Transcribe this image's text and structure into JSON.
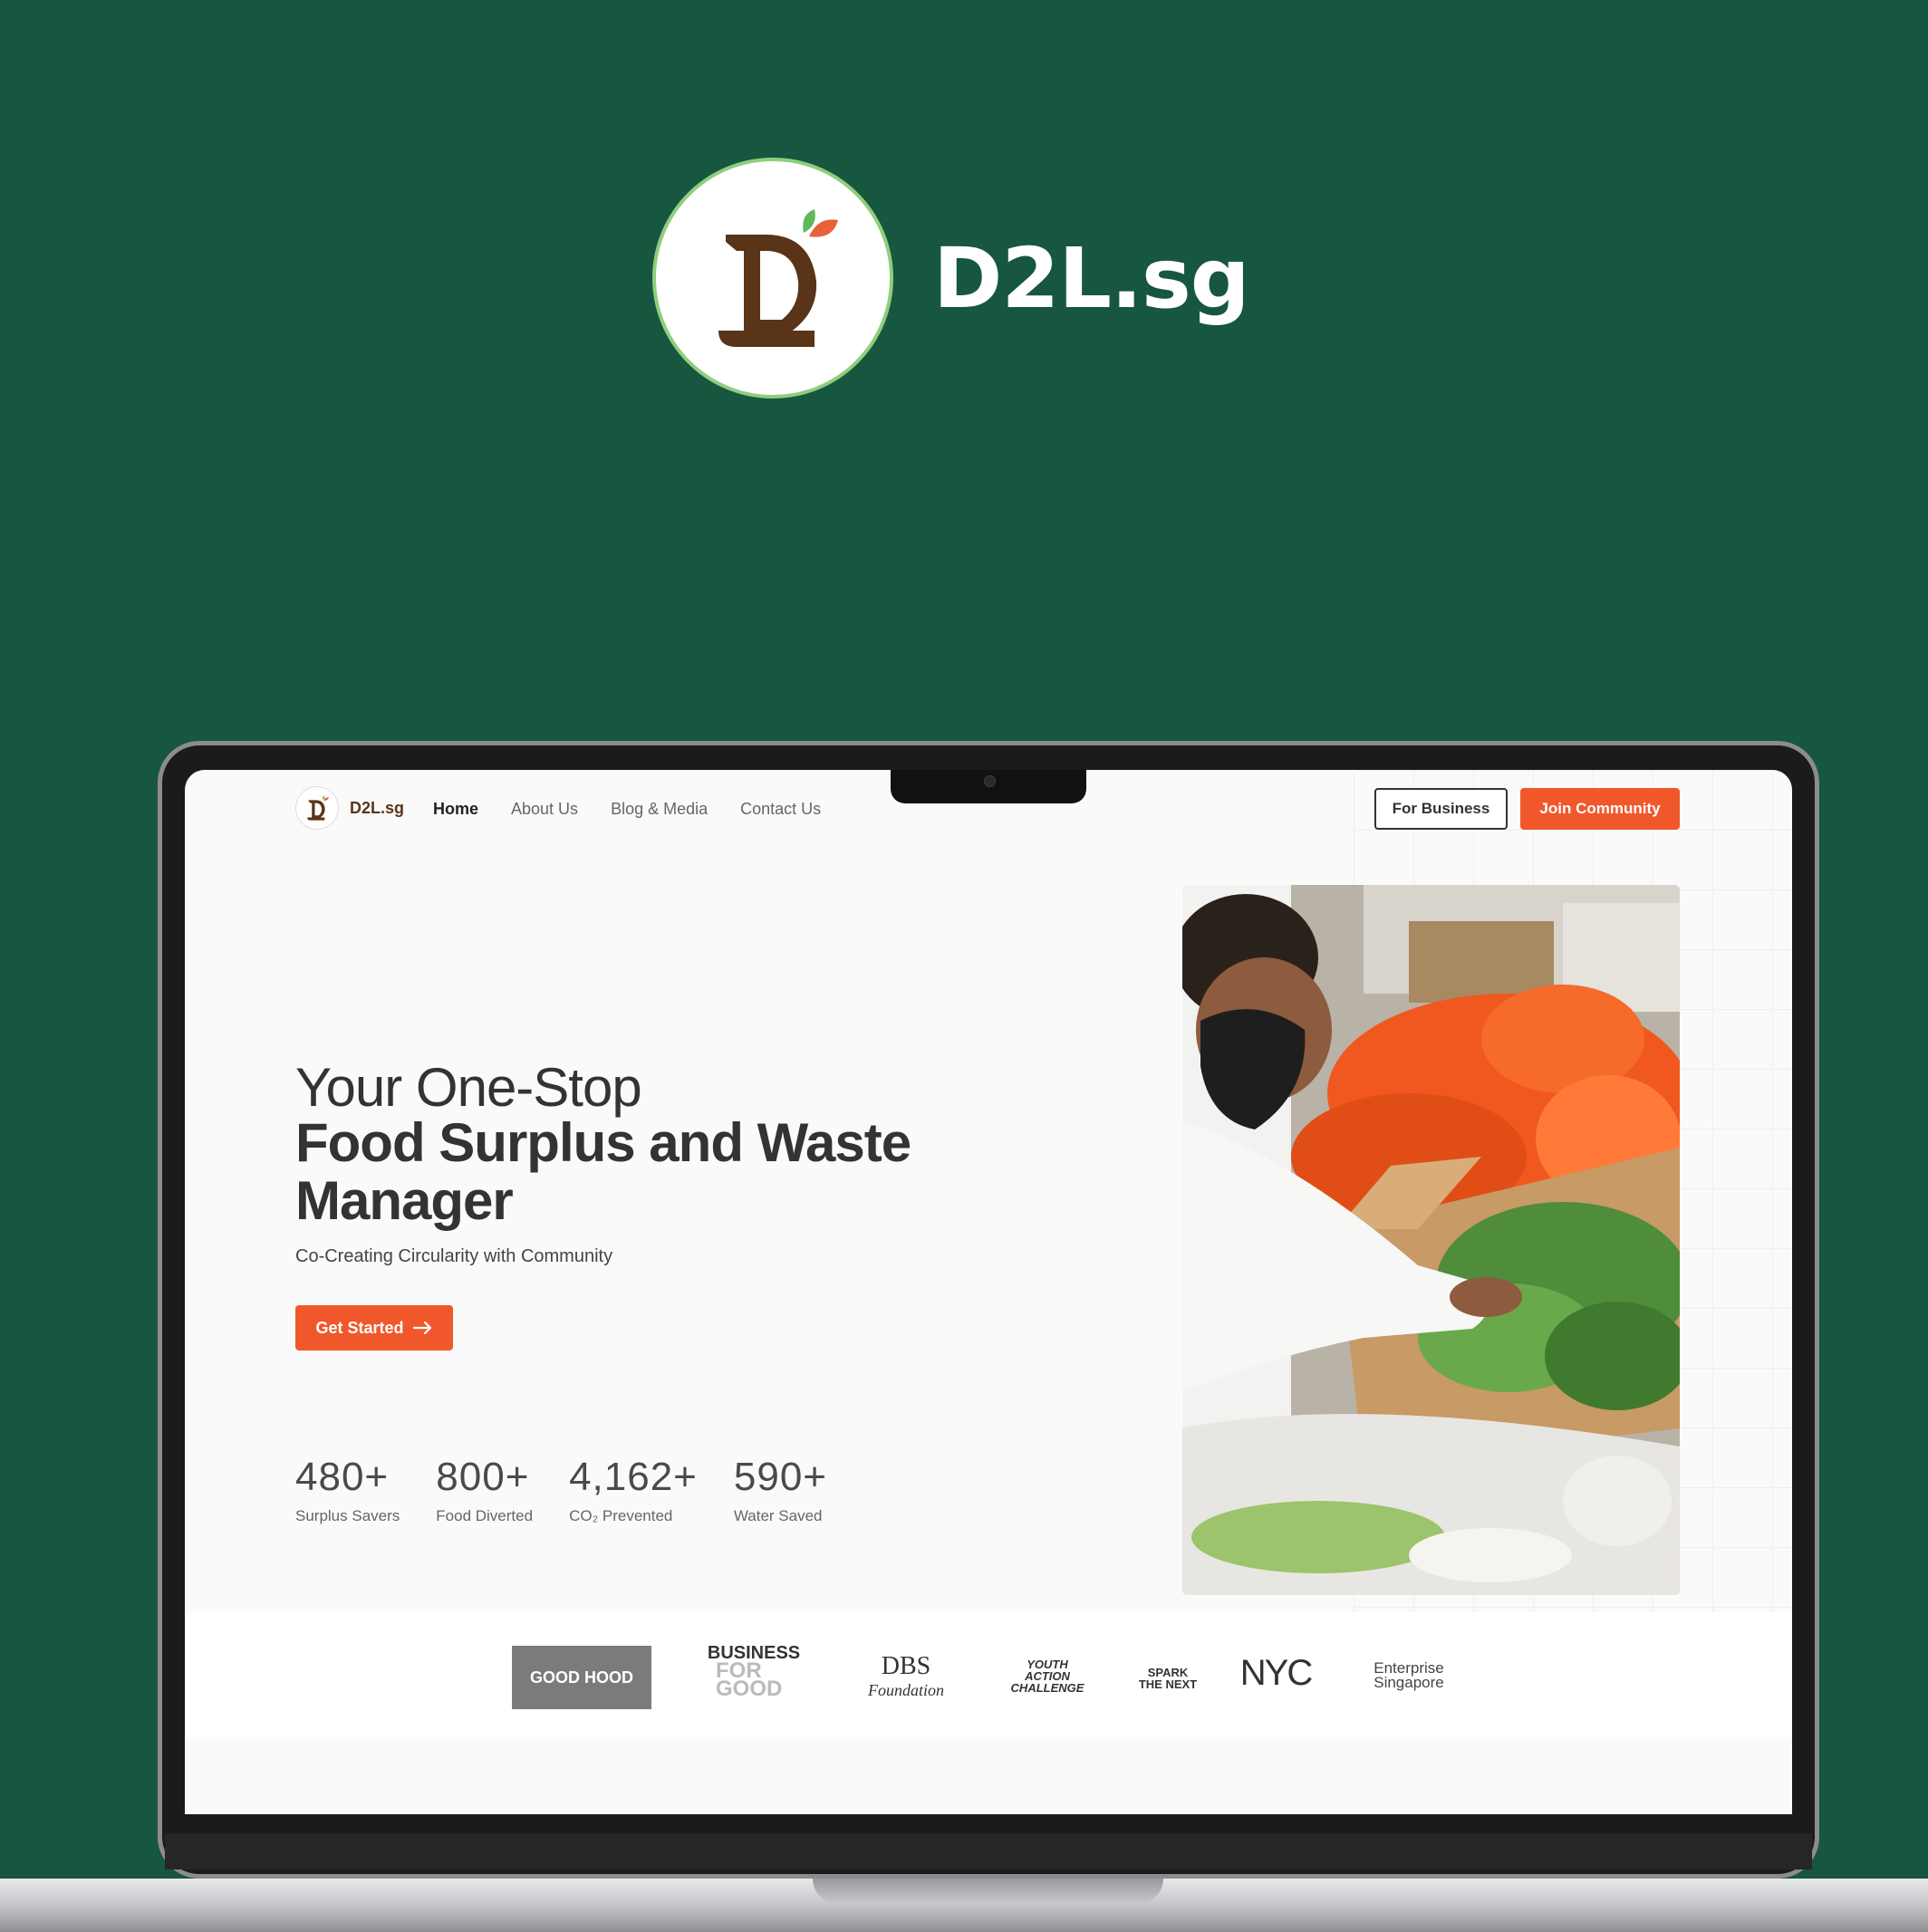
{
  "brand": {
    "name": "D2L.sg"
  },
  "nav": {
    "logo_text": "D2L.sg",
    "links": [
      "Home",
      "About Us",
      "Blog & Media",
      "Contact Us"
    ],
    "for_business": "For Business",
    "join_community": "Join Community"
  },
  "hero": {
    "line1": "Your One-Stop",
    "line2": "Food Surplus and Waste Manager",
    "subtitle": "Co-Creating Circularity with Community",
    "cta": "Get Started"
  },
  "stats": [
    {
      "value": "480+",
      "label": "Surplus Savers"
    },
    {
      "value": "800+",
      "label": "Food Diverted"
    },
    {
      "value": "4,162+",
      "label": "CO₂ Prevented"
    },
    {
      "value": "590+",
      "label": "Water Saved"
    }
  ],
  "partners": {
    "goodhood": "GOOD HOOD",
    "bfg_1": "BUSINESS",
    "bfg_2": "FOR GOOD",
    "dbs_1": "DBS",
    "dbs_2": "Foundation",
    "yac": "YOUTH ACTION CHALLENGE",
    "spark": "SPARK THE NEXT",
    "nyc": "NYC",
    "es_1": "Enterprise",
    "es_2": "Singapore"
  },
  "colors": {
    "page_bg": "#17563f",
    "accent": "#f0582b",
    "logo_brown": "#5a3418",
    "leaf_green": "#5fb85a"
  }
}
